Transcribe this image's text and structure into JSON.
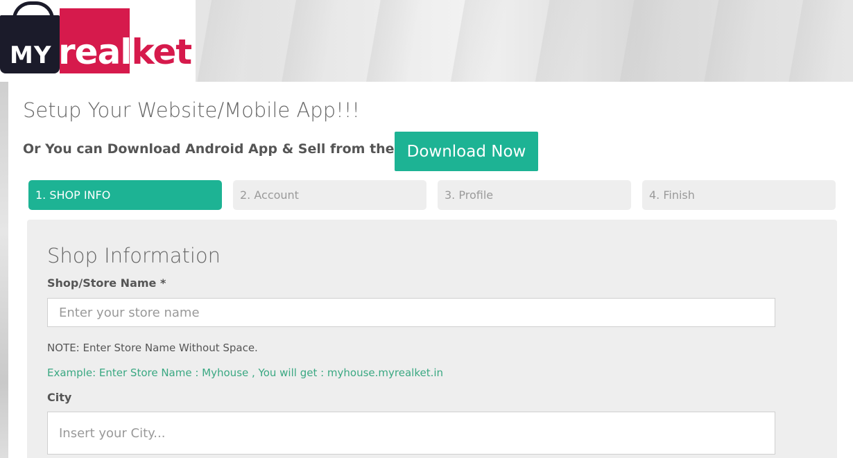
{
  "logo": {
    "my": "MY",
    "real": "real",
    "ket": "ket"
  },
  "header": {
    "title": "Setup Your Website/Mobile App!!!",
    "subtitle": "Or You can Download Android App & Sell from the App.",
    "download_label": "Download Now"
  },
  "steps": [
    {
      "label": "1. SHOP INFO",
      "active": true
    },
    {
      "label": "2. Account",
      "active": false
    },
    {
      "label": "3. Profile",
      "active": false
    },
    {
      "label": "4. Finish",
      "active": false
    }
  ],
  "form": {
    "title": "Shop Information",
    "store_name": {
      "label": "Shop/Store Name *",
      "placeholder": "Enter your store name",
      "value": ""
    },
    "note": "NOTE: Enter Store Name Without Space.",
    "example": "Example: Enter Store Name : Myhouse , You will get : myhouse.myrealket.in",
    "city": {
      "label": "City",
      "placeholder": "Insert your City...",
      "value": ""
    }
  },
  "colors": {
    "accent": "#1db394",
    "brand_red": "#d61a4c",
    "example_text": "#3aa882"
  }
}
